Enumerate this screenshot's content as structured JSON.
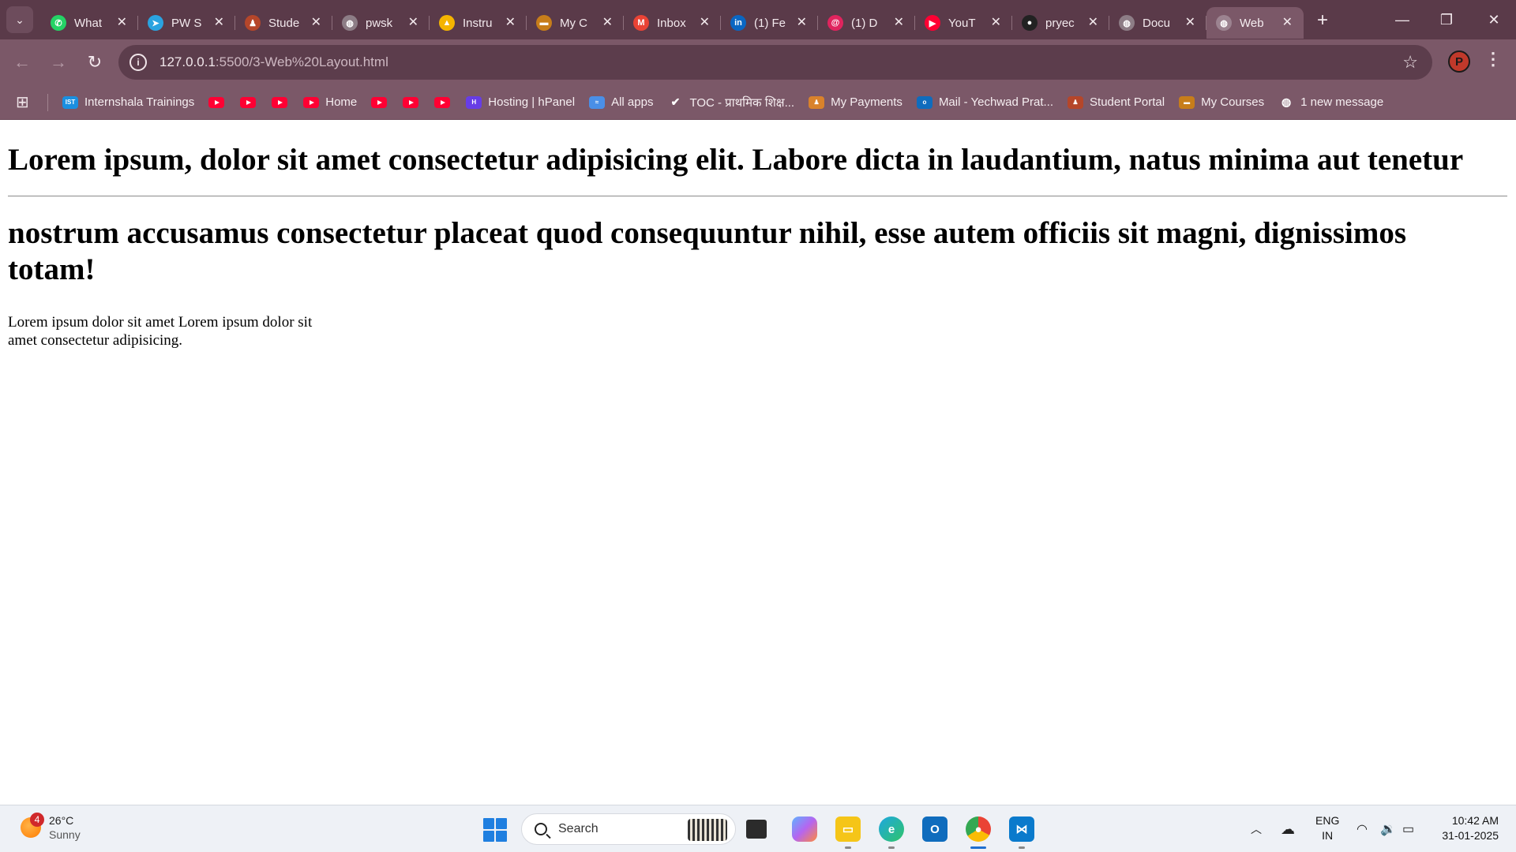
{
  "browser": {
    "tabs": [
      {
        "title": "What",
        "favicon": "whatsapp-icon",
        "color": "#25d366",
        "glyph": "✆"
      },
      {
        "title": "PW S",
        "favicon": "telegram-icon",
        "color": "#2aa3e0",
        "glyph": "➤"
      },
      {
        "title": "Stude",
        "favicon": "student-portal-icon",
        "color": "#b5462a",
        "glyph": "♟"
      },
      {
        "title": "pwsk",
        "favicon": "globe-icon",
        "color": "#8d7d86",
        "glyph": "◍"
      },
      {
        "title": "Instru",
        "favicon": "google-drive-icon",
        "color": "#f4b400",
        "glyph": "▲"
      },
      {
        "title": "My C",
        "favicon": "course-icon",
        "color": "#c77d1a",
        "glyph": "▬"
      },
      {
        "title": "Inbox",
        "favicon": "gmail-icon",
        "color": "#ea4335",
        "glyph": "M"
      },
      {
        "title": "(1) Fe",
        "favicon": "linkedin-icon",
        "color": "#0a66c2",
        "glyph": "in"
      },
      {
        "title": "(1) D",
        "favicon": "threads-icon",
        "color": "#e0245e",
        "glyph": "@"
      },
      {
        "title": "YouT",
        "favicon": "youtube-icon",
        "color": "#ff0033",
        "glyph": "▶"
      },
      {
        "title": "pryec",
        "favicon": "github-icon",
        "color": "#222222",
        "glyph": "●"
      },
      {
        "title": "Docu",
        "favicon": "globe-icon",
        "color": "#8d7d86",
        "glyph": "◍"
      },
      {
        "title": "Web",
        "favicon": "globe-icon",
        "color": "#9c8390",
        "glyph": "◍",
        "active": true
      }
    ],
    "url_host": "127.0.0.1",
    "url_path": ":5500/3-Web%20Layout.html",
    "profile_initial": "P",
    "bookmarks": [
      {
        "label": "Internshala Trainings",
        "icon": "internshala-icon",
        "color": "#1a8fe0",
        "glyph": "IST"
      },
      {
        "label": "",
        "icon": "youtube-icon"
      },
      {
        "label": "",
        "icon": "youtube-icon"
      },
      {
        "label": "",
        "icon": "youtube-icon"
      },
      {
        "label": "Home",
        "icon": "youtube-icon"
      },
      {
        "label": "",
        "icon": "youtube-icon"
      },
      {
        "label": "",
        "icon": "youtube-icon"
      },
      {
        "label": "",
        "icon": "youtube-icon"
      },
      {
        "label": "Hosting | hPanel",
        "icon": "hostinger-icon",
        "color": "#673de6",
        "glyph": "H"
      },
      {
        "label": "All apps",
        "icon": "all-apps-icon",
        "color": "#4a8fe7",
        "glyph": "≈"
      },
      {
        "label": "TOC - प्राथमिक शिक्ष...",
        "icon": "toc-icon",
        "color": "#ffffff",
        "glyph": "✔"
      },
      {
        "label": "My Payments",
        "icon": "payments-icon",
        "color": "#d9822b",
        "glyph": "♟"
      },
      {
        "label": "Mail - Yechwad Prat...",
        "icon": "outlook-icon",
        "color": "#0f6cbd",
        "glyph": "o"
      },
      {
        "label": "Student Portal",
        "icon": "student-portal-icon",
        "color": "#b5462a",
        "glyph": "♟"
      },
      {
        "label": "My Courses",
        "icon": "course-icon",
        "color": "#c77d1a",
        "glyph": "▬"
      },
      {
        "label": "1 new message",
        "icon": "globe-icon",
        "color": "#ffffff",
        "glyph": "◍"
      }
    ]
  },
  "page": {
    "heading1": "Lorem ipsum, dolor sit amet consectetur adipisicing elit. Labore dicta in laudantium, natus minima aut tenetur",
    "heading2": "nostrum accusamus consectetur placeat quod consequuntur nihil, esse autem officiis sit magni, dignissimos totam!",
    "paragraph": "Lorem ipsum dolor sit amet Lorem ipsum dolor sit amet consectetur adipisicing."
  },
  "taskbar": {
    "weather_temp": "26°C",
    "weather_condition": "Sunny",
    "weather_badge": "4",
    "search_label": "Search",
    "language": "ENG",
    "region": "IN",
    "time": "10:42 AM",
    "date": "31-01-2025"
  }
}
